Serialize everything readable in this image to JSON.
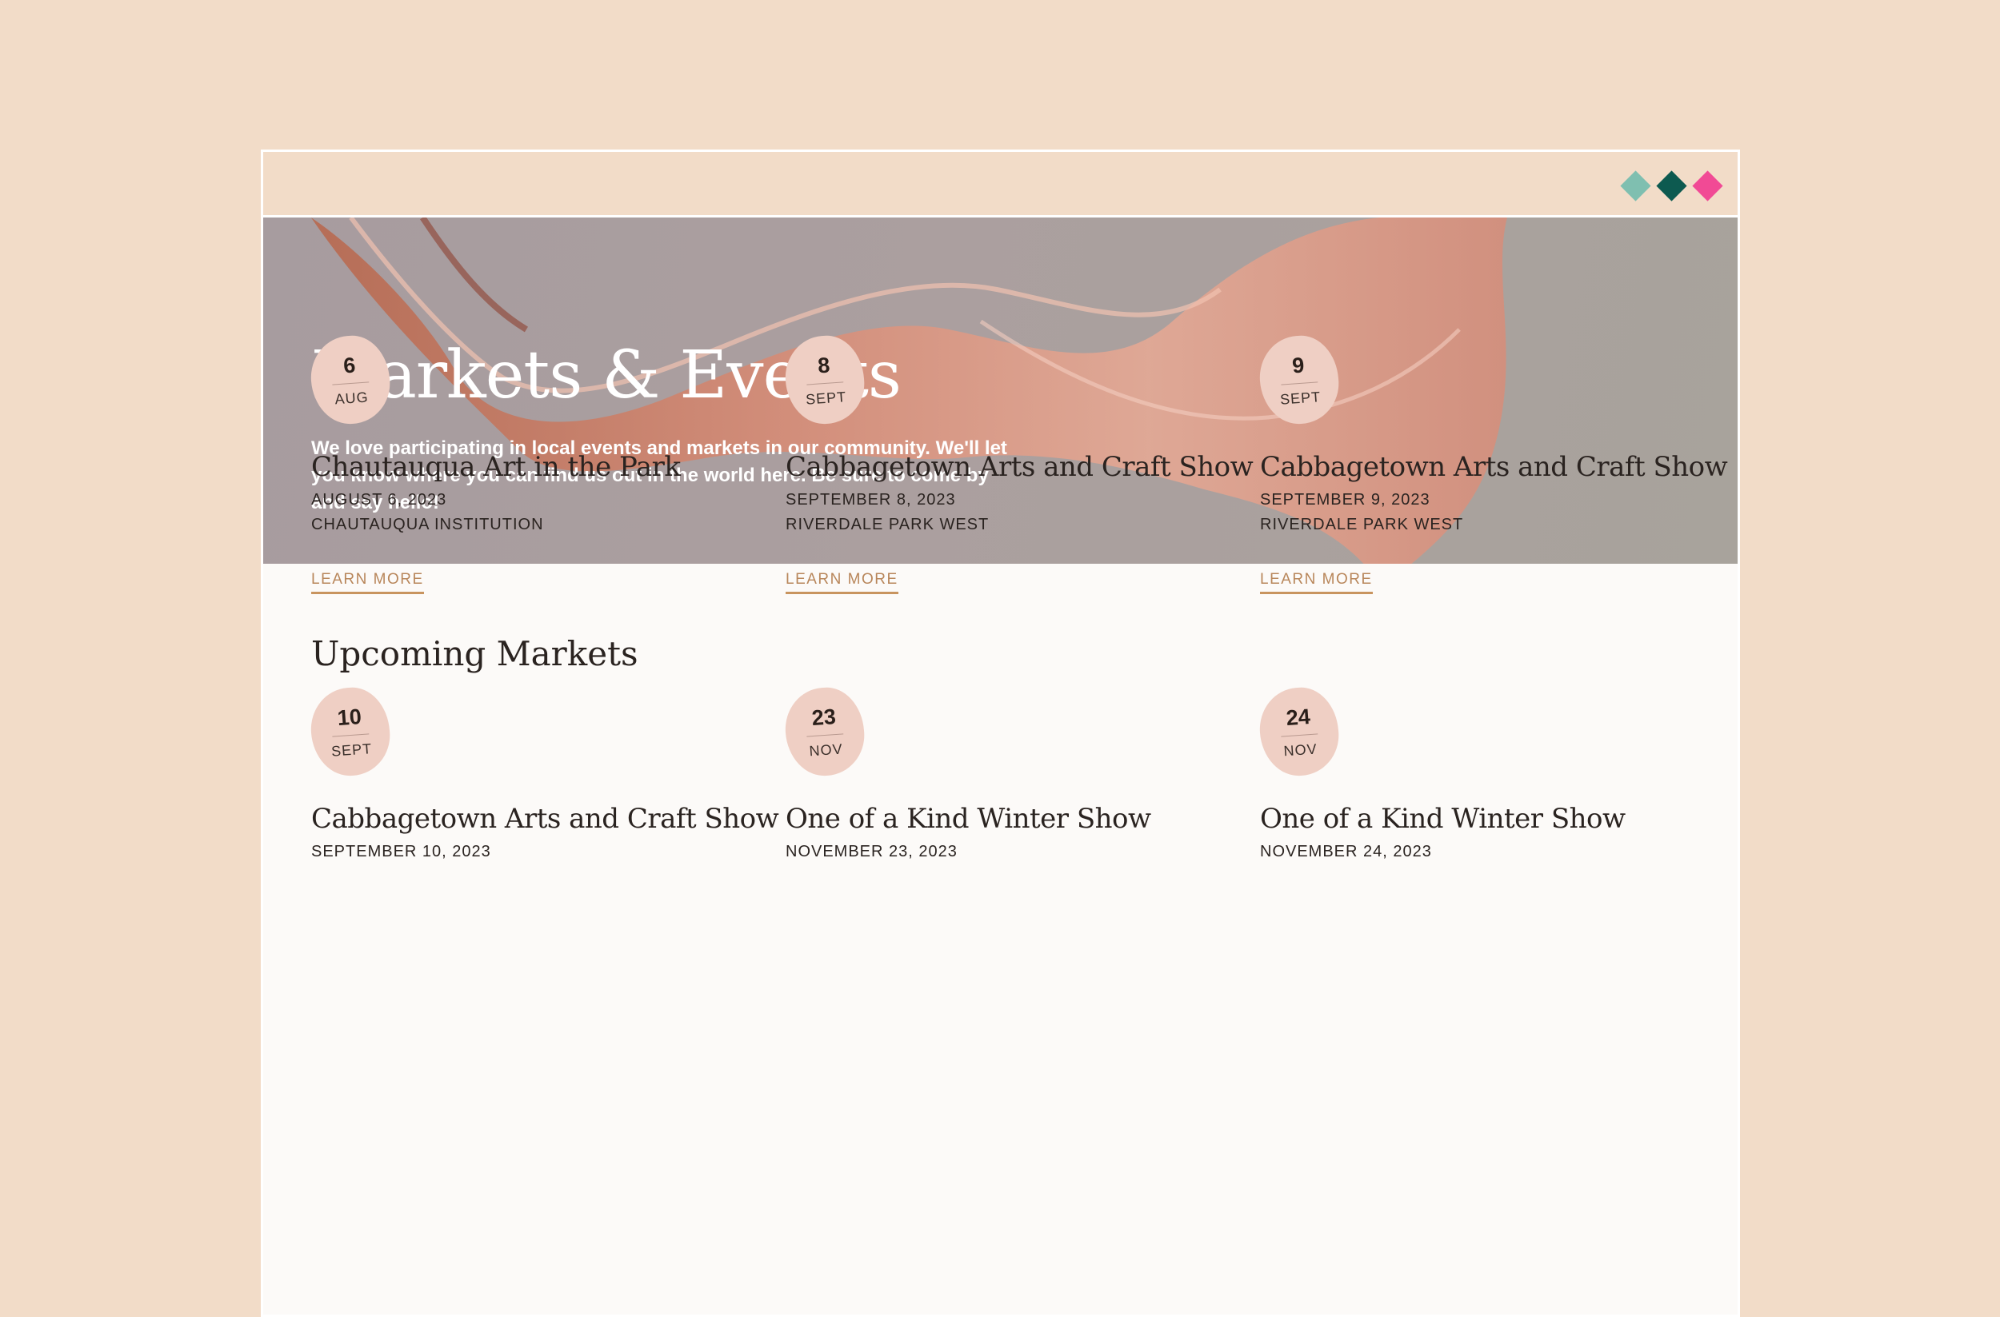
{
  "window": {
    "controls": [
      {
        "name": "teal-diamond",
        "color": "#7fbfb0"
      },
      {
        "name": "dark-green-diamond",
        "color": "#0d5a50"
      },
      {
        "name": "pink-diamond",
        "color": "#f14a95"
      }
    ]
  },
  "hero": {
    "title": "Markets & Events",
    "description": "We love participating in local events and markets in our community. We'll let you know where you can find us out in the world here. Be sure to come by and say hello!"
  },
  "section": {
    "title": "Upcoming Markets"
  },
  "events": [
    {
      "day": "6",
      "month": "AUG",
      "title": "Chautauqua Art in the Park",
      "date": "AUGUST 6, 2023",
      "venue": "CHAUTAUQUA INSTITUTION",
      "link": "LEARN MORE"
    },
    {
      "day": "8",
      "month": "SEPT",
      "title": "Cabbagetown Arts and Craft Show",
      "date": "SEPTEMBER 8, 2023",
      "venue": "RIVERDALE PARK WEST",
      "link": "LEARN MORE"
    },
    {
      "day": "9",
      "month": "SEPT",
      "title": "Cabbagetown Arts and Craft Show",
      "date": "SEPTEMBER 9, 2023",
      "venue": "RIVERDALE PARK WEST",
      "link": "LEARN MORE"
    },
    {
      "day": "10",
      "month": "SEPT",
      "title": "Cabbagetown Arts and Craft Show",
      "date": "SEPTEMBER 10, 2023",
      "venue": "",
      "link": ""
    },
    {
      "day": "23",
      "month": "NOV",
      "title": "One of a Kind Winter Show",
      "date": "NOVEMBER 23, 2023",
      "venue": "",
      "link": ""
    },
    {
      "day": "24",
      "month": "NOV",
      "title": "One of a Kind Winter Show",
      "date": "NOVEMBER 24, 2023",
      "venue": "",
      "link": ""
    }
  ]
}
